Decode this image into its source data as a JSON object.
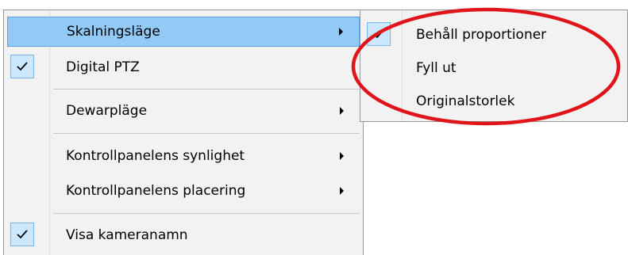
{
  "main_menu": {
    "items": [
      {
        "label": "Skalningsläge"
      },
      {
        "label": "Digital PTZ"
      },
      {
        "label": "Dewarpläge"
      },
      {
        "label": "Kontrollpanelens synlighet"
      },
      {
        "label": "Kontrollpanelens placering"
      },
      {
        "label": "Visa kameranamn"
      }
    ]
  },
  "sub_menu": {
    "items": [
      {
        "label": "Behåll proportioner"
      },
      {
        "label": "Fyll ut"
      },
      {
        "label": "Originalstorlek"
      }
    ]
  },
  "colors": {
    "highlight": "#91c9f7",
    "annotation_ellipse": "#e0141b"
  },
  "icons": [
    "check-icon",
    "submenu-arrow-icon"
  ]
}
